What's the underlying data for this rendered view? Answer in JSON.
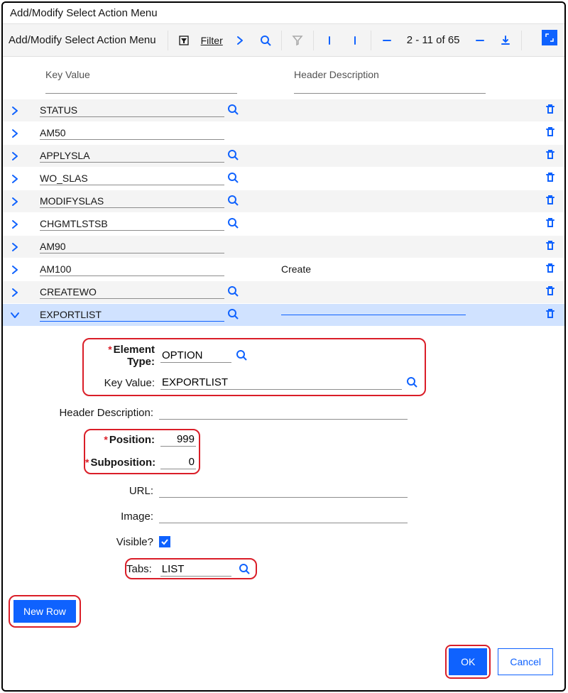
{
  "dialog": {
    "title": "Add/Modify Select Action Menu"
  },
  "toolbar": {
    "title": "Add/Modify Select Action Menu",
    "filter_label": "Filter",
    "pager": "2  -  11  of  65"
  },
  "columns": {
    "key": "Key Value",
    "desc": "Header Description"
  },
  "rows": [
    {
      "key": "STATUS",
      "desc": "",
      "has_lookup": true
    },
    {
      "key": "AM50",
      "desc": "",
      "has_lookup": false
    },
    {
      "key": "APPLYSLA",
      "desc": "",
      "has_lookup": true
    },
    {
      "key": "WO_SLAS",
      "desc": "",
      "has_lookup": true
    },
    {
      "key": "MODIFYSLAS",
      "desc": "",
      "has_lookup": true
    },
    {
      "key": "CHGMTLSTSB",
      "desc": "",
      "has_lookup": true
    },
    {
      "key": "AM90",
      "desc": "",
      "has_lookup": false
    },
    {
      "key": "AM100",
      "desc": "Create",
      "has_lookup": false
    },
    {
      "key": "CREATEWO",
      "desc": "",
      "has_lookup": true
    },
    {
      "key": "EXPORTLIST",
      "desc": "",
      "has_lookup": true
    }
  ],
  "detail": {
    "labels": {
      "element_type": "Element Type:",
      "key_value": "Key Value:",
      "header_desc": "Header Description:",
      "position": "Position:",
      "subposition": "Subposition:",
      "url": "URL:",
      "image": "Image:",
      "visible": "Visible?",
      "tabs": "Tabs:"
    },
    "element_type": "OPTION",
    "key_value": "EXPORTLIST",
    "header_desc": "",
    "position": "999",
    "subposition": "0",
    "url": "",
    "image": "",
    "visible": true,
    "tabs": "LIST"
  },
  "buttons": {
    "new_row": "New Row",
    "ok": "OK",
    "cancel": "Cancel"
  }
}
